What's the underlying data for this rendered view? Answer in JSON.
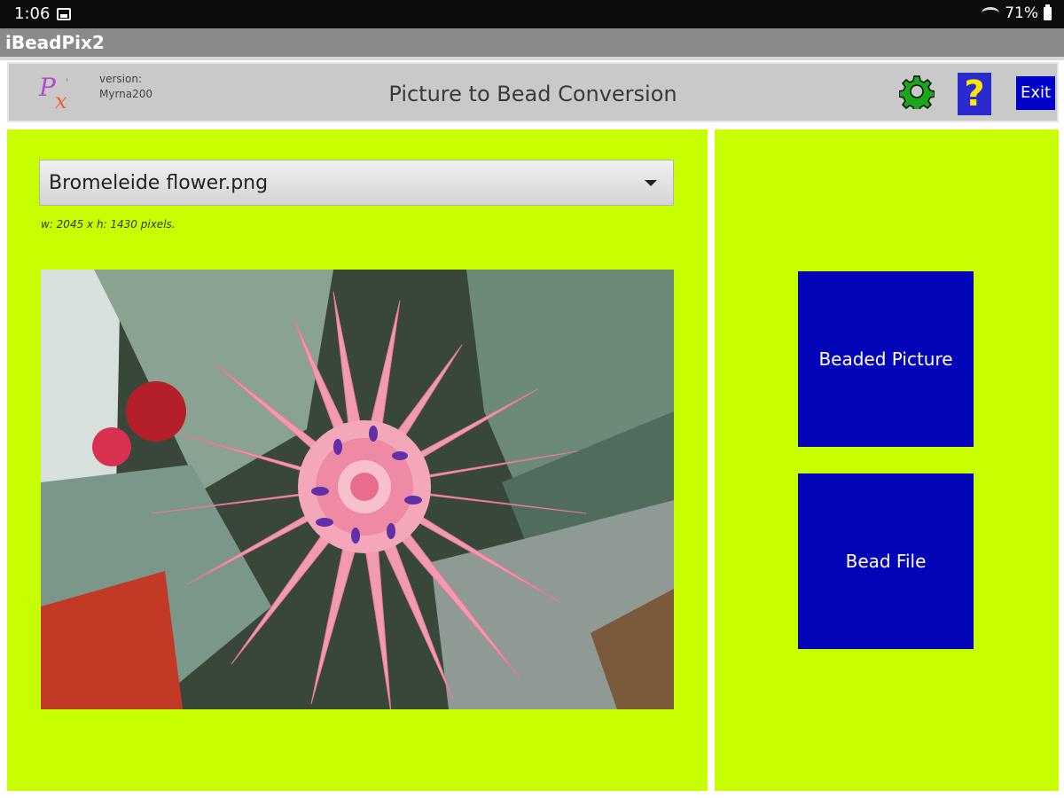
{
  "status_bar": {
    "time": "1:06",
    "battery": "71%"
  },
  "app": {
    "title": "iBeadPix2"
  },
  "header": {
    "version_label": "version:",
    "version_value": "Myrna200",
    "page_title": "Picture to Bead Conversion",
    "exit_label": "Exit",
    "help_label": "?",
    "icons": [
      "app-logo-icon",
      "gear-icon",
      "help-icon"
    ]
  },
  "image_picker": {
    "selected_file": "Bromeleide flower.png",
    "dimensions_text": "w: 2045  x  h: 1430 pixels."
  },
  "actions": {
    "beaded_picture_label": "Beaded Picture",
    "bead_file_label": "Bead File"
  },
  "colors": {
    "panel_background": "#c8ff00",
    "button_blue": "#0404b8",
    "header_gray": "#c9c9c9"
  }
}
